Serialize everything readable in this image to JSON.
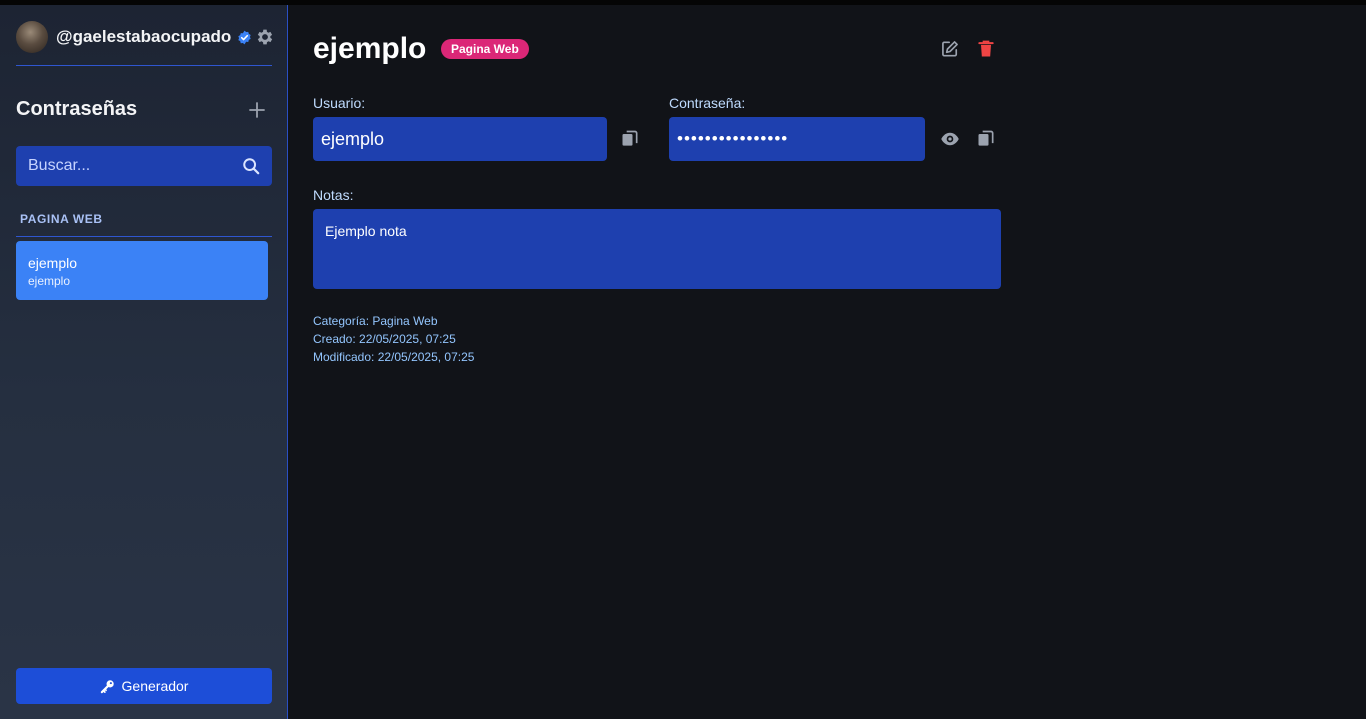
{
  "colors": {
    "accent": "#1e40af",
    "selected_item": "#3b82f6",
    "badge": "#db2777",
    "delete": "#ef4444",
    "verified": "#3b82f6"
  },
  "sidebar": {
    "username": "@gaelestabaocupado",
    "section_title": "Contraseñas",
    "search_placeholder": "Buscar...",
    "category_label": "PAGINA WEB",
    "items": [
      {
        "title": "ejemplo",
        "subtitle": "ejemplo"
      }
    ],
    "generator_label": "Generador"
  },
  "detail": {
    "title": "ejemplo",
    "badge": "Pagina Web",
    "user_label": "Usuario:",
    "user_value": "ejemplo",
    "password_label": "Contraseña:",
    "password_masked": "••••••••••••••••",
    "notes_label": "Notas:",
    "notes_value": "Ejemplo nota",
    "category_line": "Categoría: Pagina Web",
    "created_line": "Creado: 22/05/2025, 07:25",
    "modified_line": "Modificado: 22/05/2025, 07:25"
  },
  "icons": {
    "verified": "verified-badge-icon",
    "settings": "gear-icon",
    "add": "plus-icon",
    "search": "search-icon",
    "key": "key-icon",
    "edit": "edit-icon",
    "delete": "trash-icon",
    "copy": "copy-icon",
    "show": "eye-icon"
  }
}
